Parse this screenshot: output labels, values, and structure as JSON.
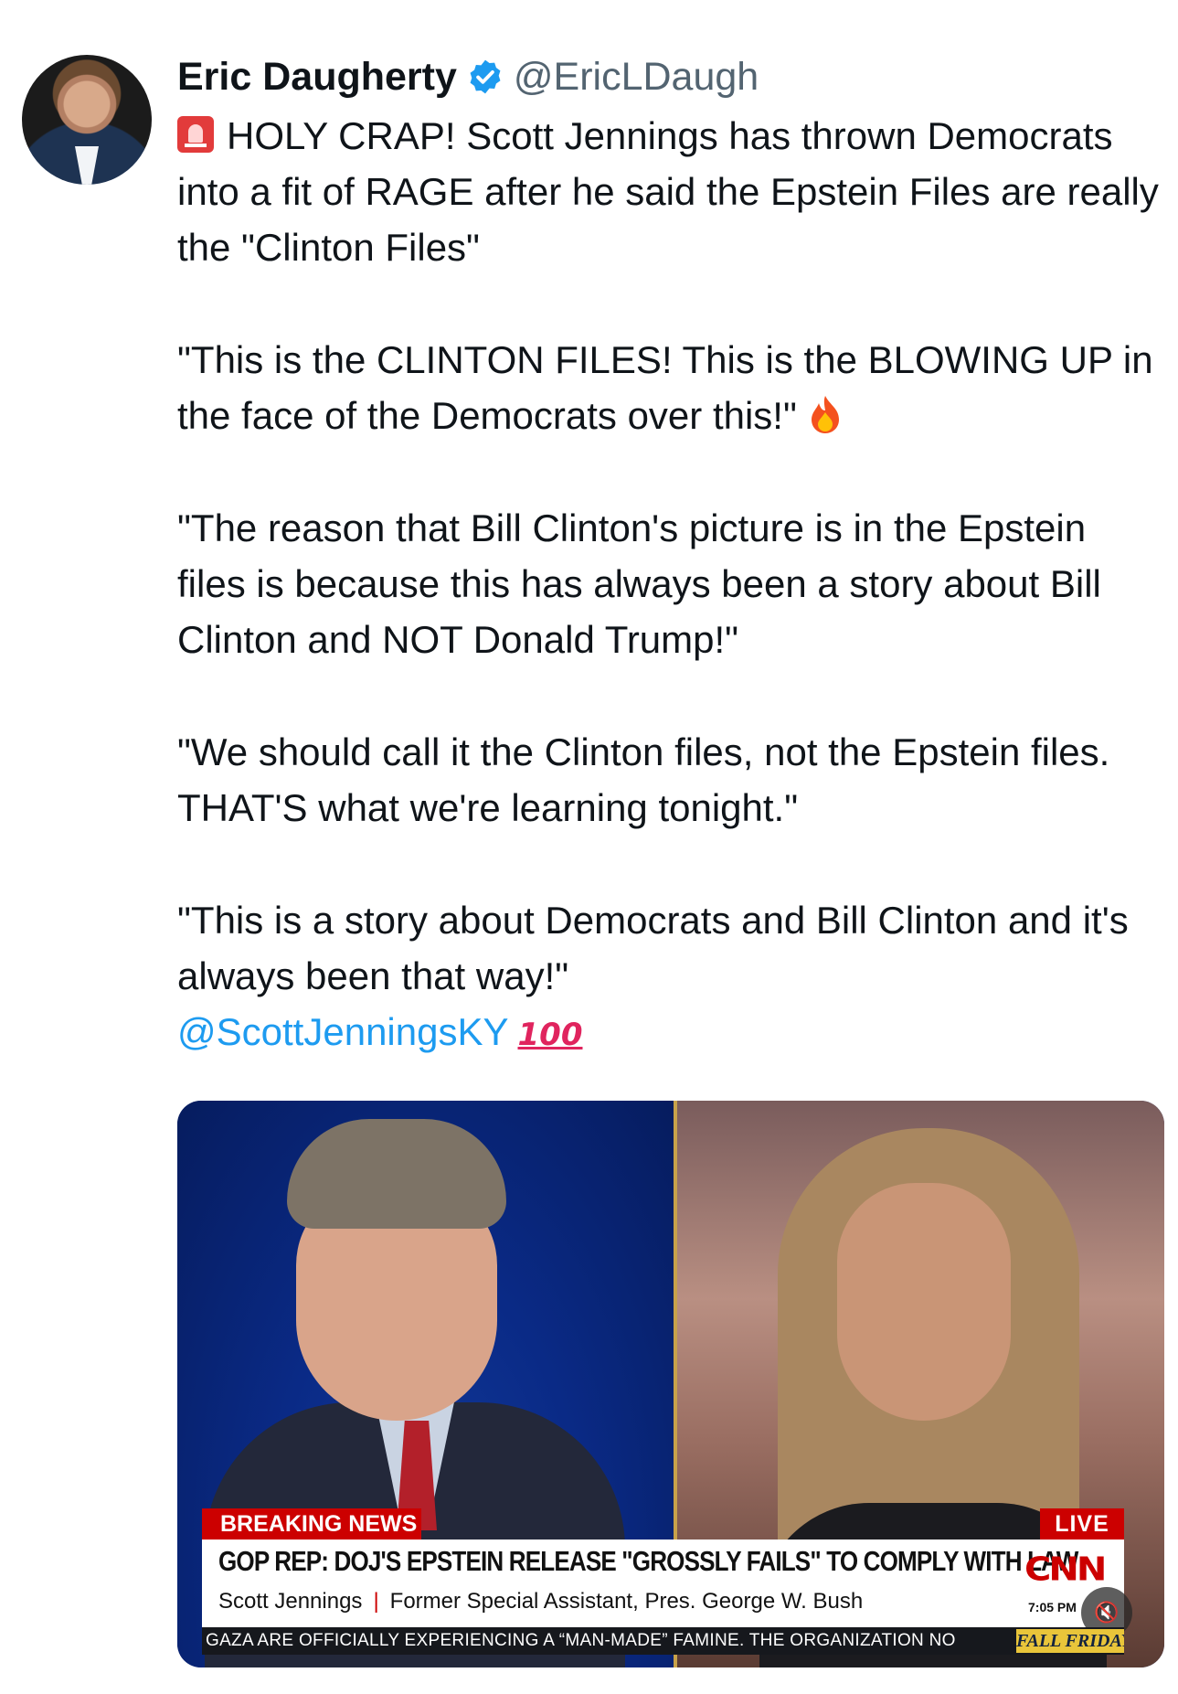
{
  "author": {
    "name": "Eric Daugherty",
    "handle": "@EricLDaugh",
    "verified": true
  },
  "tweet": {
    "line1": "HOLY CRAP! Scott Jennings has thrown Democrats into a fit of RAGE after he said the Epstein Files are really the \"Clinton Files\"",
    "quote1": "\"This is the CLINTON FILES! This is the BLOWING UP in the face of the Democrats over this!\"",
    "quote2": "\"The reason that Bill Clinton's picture is in the Epstein files is because this has always been a story about Bill Clinton and NOT Donald Trump!\"",
    "quote3": "\"We should call it the Clinton files, not the Epstein files. THAT'S what we're learning tonight.\"",
    "quote4": "\"This is a story about Democrats and Bill Clinton and it's always been that way!\"",
    "mention": "@ScottJenningsKY",
    "icons": [
      "siren-icon",
      "fire-icon",
      "hundred-points-icon"
    ]
  },
  "video": {
    "breaking_label": "BREAKING NEWS",
    "live_label": "LIVE",
    "headline": "GOP REP: DOJ'S EPSTEIN RELEASE \"GROSSLY FAILS\" TO COMPLY WITH LAW",
    "guest_name": "Scott Jennings",
    "separator": "|",
    "guest_title": "Former Special Assistant, Pres. George W. Bush",
    "network_logo": "CNN",
    "time": "7:05 PM",
    "ticker": "GAZA ARE OFFICIALLY EXPERIENCING A “MAN-MADE” FAMINE. THE ORGANIZATION NO",
    "promo": "FALL FRIDAYS",
    "mute_icon": "speaker-muted-icon"
  },
  "colors": {
    "link": "#1d9bf0",
    "cnn_red": "#cc0000",
    "handle_gray": "#536471"
  }
}
